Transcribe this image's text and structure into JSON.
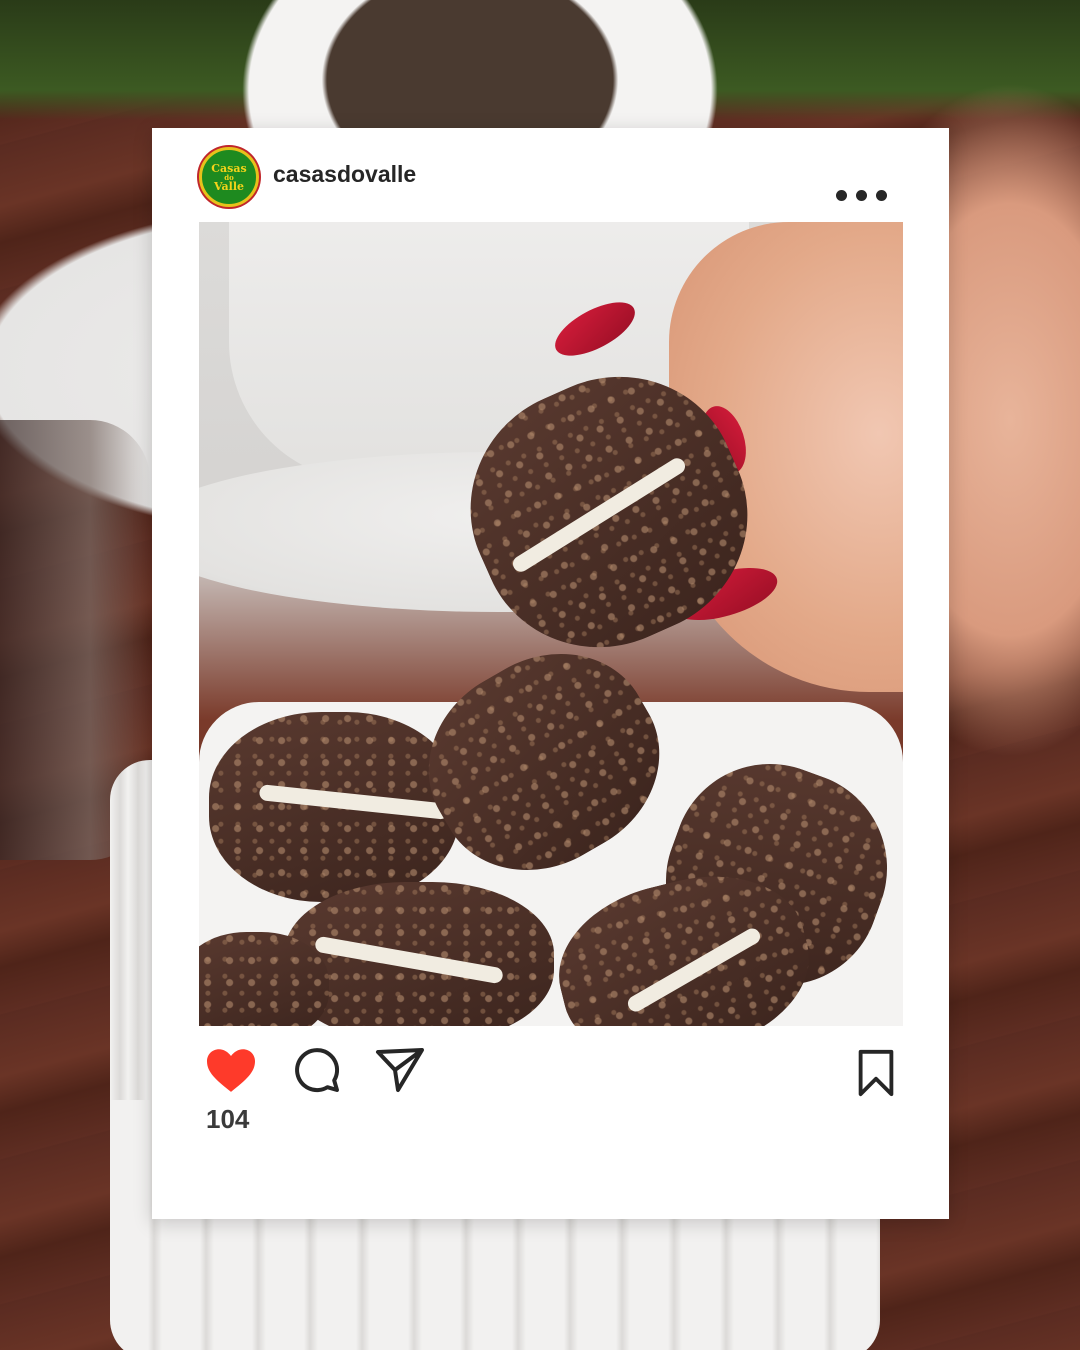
{
  "post": {
    "username": "casasdovalle",
    "avatar": {
      "line1": "Casas",
      "line2": "do",
      "line3": "Valle",
      "bg_color": "#1e8a1f",
      "text_color": "#f4d31a"
    },
    "more_icon": "more-horizontal-icon",
    "likes": "104"
  },
  "actions": {
    "like_icon": "heart-filled-icon",
    "like_color": "#fe3a2a",
    "comment_icon": "comment-icon",
    "share_icon": "send-icon",
    "save_icon": "bookmark-icon"
  }
}
